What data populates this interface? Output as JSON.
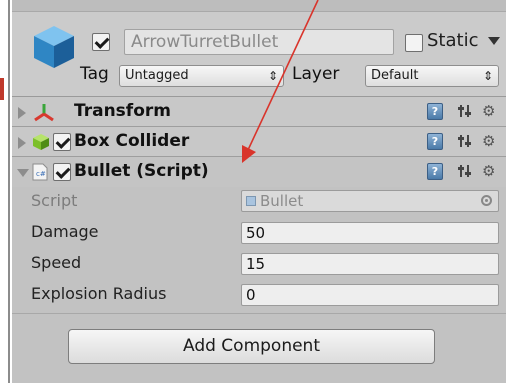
{
  "gameobject": {
    "name": "ArrowTurretBullet",
    "active": true,
    "static_label": "Static",
    "tag_label": "Tag",
    "tag_value": "Untagged",
    "layer_label": "Layer",
    "layer_value": "Default"
  },
  "components": [
    {
      "title": "Transform",
      "icon": "transform-axes-icon"
    },
    {
      "title": "Box Collider",
      "icon": "box-collider-icon",
      "enabled": true
    },
    {
      "title": "Bullet (Script)",
      "icon": "script-file-icon",
      "enabled": true,
      "expanded": true
    }
  ],
  "bullet_properties": {
    "script_label": "Script",
    "script_value": "Bullet",
    "damage_label": "Damage",
    "damage_value": "50",
    "speed_label": "Speed",
    "speed_value": "15",
    "explosion_label": "Explosion Radius",
    "explosion_value": "0"
  },
  "add_component_label": "Add Component",
  "help_glyph": "?",
  "gear_glyph": "⚙",
  "colors": {
    "annotation_arrow": "#d9342b",
    "panel_bg": "#c2c2c2",
    "help_blue": "#4b7aa8"
  }
}
